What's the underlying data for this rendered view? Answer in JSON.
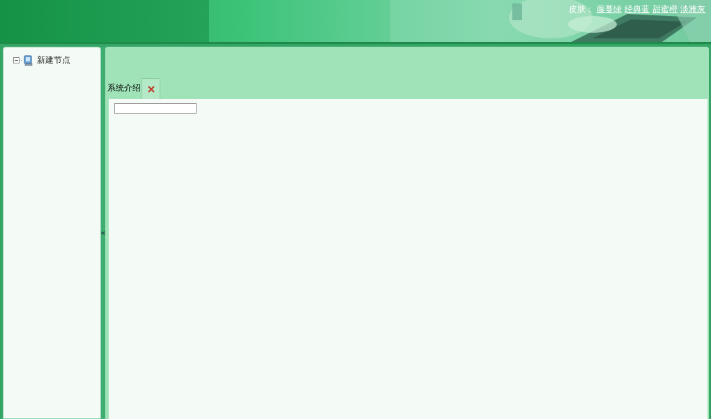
{
  "header": {
    "skin_label": "皮肤：",
    "skins": [
      {
        "label": "藤蔓绿"
      },
      {
        "label": "经典蓝"
      },
      {
        "label": "甜蜜橙"
      },
      {
        "label": "淡雅灰"
      }
    ]
  },
  "tree": [
    {
      "label": "新建节点",
      "expanded": true
    }
  ],
  "splitter": {
    "symbol": "«"
  },
  "tabs": [
    {
      "label": "系统介绍",
      "selected": true
    }
  ]
}
